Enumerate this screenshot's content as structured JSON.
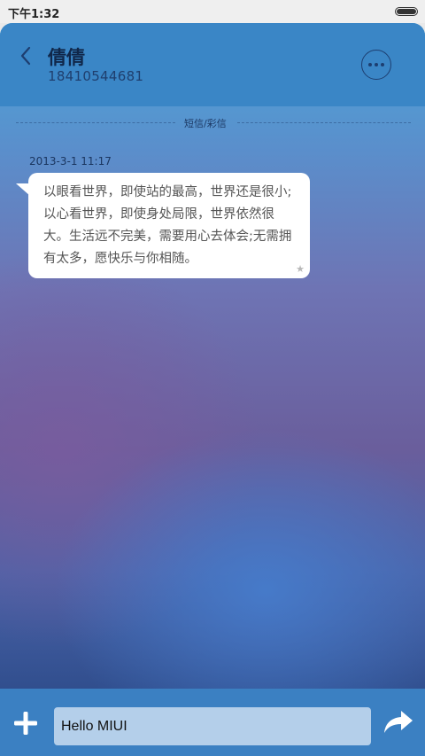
{
  "status_bar": {
    "time": "下午1:32",
    "battery_level": 1.0
  },
  "header": {
    "contact_name": "倩倩",
    "contact_number": "18410544681"
  },
  "conversation": {
    "divider_label": "短信/彩信",
    "messages": [
      {
        "timestamp": "2013-3-1 11:17",
        "text": "以眼看世界，即使站的最高，世界还是很小;以心看世界，即使身处局限，世界依然很大。生活远不完美，需要用心去体会;无需拥有太多，愿快乐与你相随。",
        "starred": false
      }
    ]
  },
  "composer": {
    "input_value": "Hello MIUI"
  },
  "colors": {
    "header_bg": "#3a86c6",
    "input_bar_bg": "#3b80c2",
    "input_field_bg": "#b4cfea",
    "bubble_bg": "#ffffff"
  },
  "icons": {
    "back": "back-chevron-icon",
    "more": "more-options-icon",
    "add": "plus-icon",
    "send": "send-arrow-icon",
    "star": "star-icon"
  }
}
